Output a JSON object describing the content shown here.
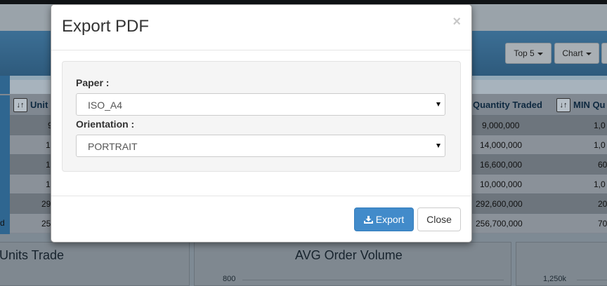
{
  "background": {
    "header_buttons": [
      "Top 5",
      "Chart"
    ],
    "grid": {
      "headers": [
        "Unit",
        "Quantity Traded",
        "MIN Qu"
      ],
      "rows": [
        {
          "a": "9",
          "qty": "9,000,000",
          "min": "1,0"
        },
        {
          "a": "1",
          "qty": "14,000,000",
          "min": "1,0"
        },
        {
          "a": "1",
          "qty": "16,600,000",
          "min": "60"
        },
        {
          "a": "1",
          "qty": "10,000,000",
          "min": "1,0"
        },
        {
          "a": "29",
          "qty": "292,600,000",
          "min": "20"
        },
        {
          "a": "25",
          "qty": "256,700,000",
          "min": "70",
          "left_label": "d"
        }
      ]
    },
    "panels": {
      "left_title": "Units Trade",
      "middle_title": "AVG Order Volume",
      "middle_axis_label": "800",
      "right_axis_label": "1,250k"
    }
  },
  "modal": {
    "title": "Export PDF",
    "close_symbol": "×",
    "paper_label": "Paper :",
    "paper_value": "ISO_A4",
    "orientation_label": "Orientation :",
    "orientation_value": "PORTRAIT",
    "export_label": "Export",
    "close_label": "Close"
  },
  "colors": {
    "primary": "#428bca",
    "overlay_header": "#2e5a7c"
  }
}
